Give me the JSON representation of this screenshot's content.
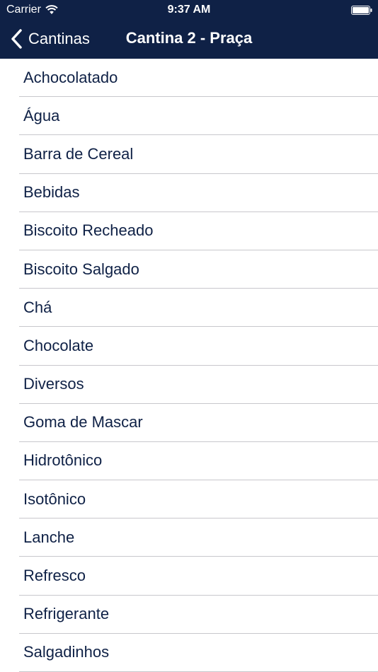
{
  "status_bar": {
    "carrier": "Carrier",
    "time": "9:37 AM"
  },
  "nav": {
    "back_label": "Cantinas",
    "title": "Cantina 2 - Praça"
  },
  "colors": {
    "header_background": "#0f2146",
    "item_text": "#0f2146",
    "separator": "#c8c7cc"
  },
  "list": {
    "items": [
      "Achocolatado",
      "Água",
      "Barra de Cereal",
      "Bebidas",
      "Biscoito Recheado",
      "Biscoito Salgado",
      "Chá",
      "Chocolate",
      "Diversos",
      "Goma de Mascar",
      "Hidrotônico",
      "Isotônico",
      "Lanche",
      "Refresco",
      "Refrigerante",
      "Salgadinhos"
    ]
  }
}
